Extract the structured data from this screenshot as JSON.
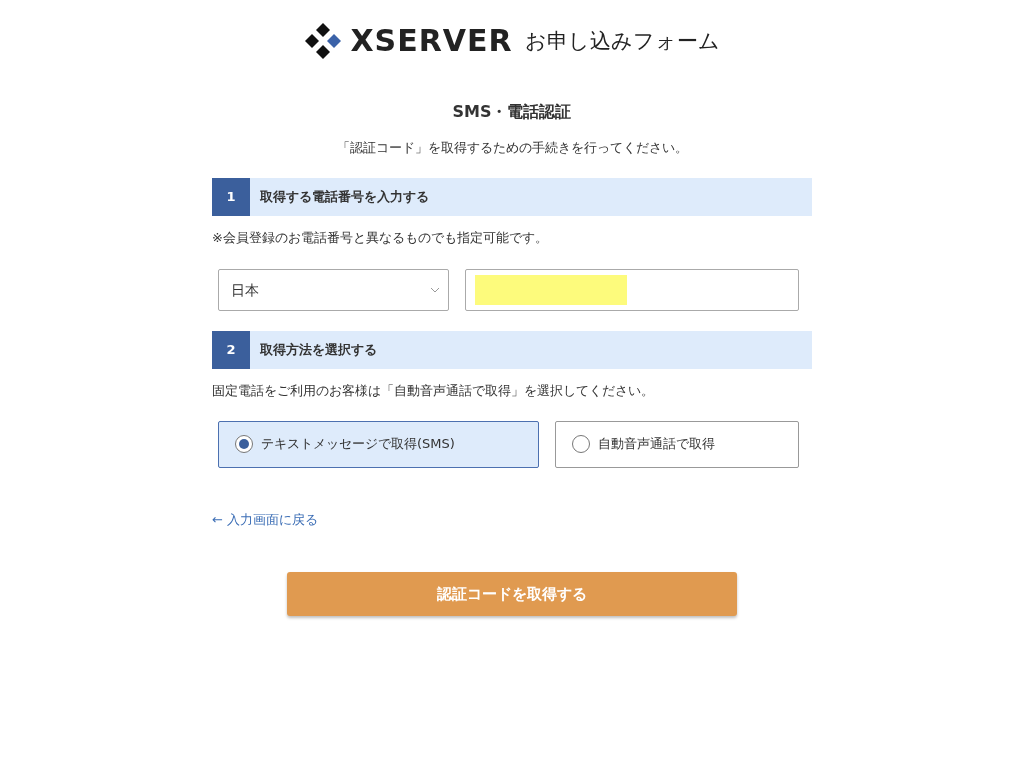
{
  "header": {
    "brand": "XSERVER",
    "form_title": "お申し込みフォーム"
  },
  "title": "SMS・電話認証",
  "subtitle": "「認証コード」を取得するための手続きを行ってください。",
  "step1": {
    "number": "1",
    "heading": "取得する電話番号を入力する",
    "note": "※会員登録のお電話番号と異なるものでも指定可能です。",
    "country": "日本",
    "phone_redacted": true
  },
  "step2": {
    "number": "2",
    "heading": "取得方法を選択する",
    "note": "固定電話をご利用のお客様は「自動音声通話で取得」を選択してください。",
    "methods": [
      {
        "label": "テキストメッセージで取得(SMS)",
        "selected": true
      },
      {
        "label": "自動音声通話で取得",
        "selected": false
      }
    ]
  },
  "back_link": "← 入力画面に戻る",
  "submit_button": "認証コードを取得する"
}
